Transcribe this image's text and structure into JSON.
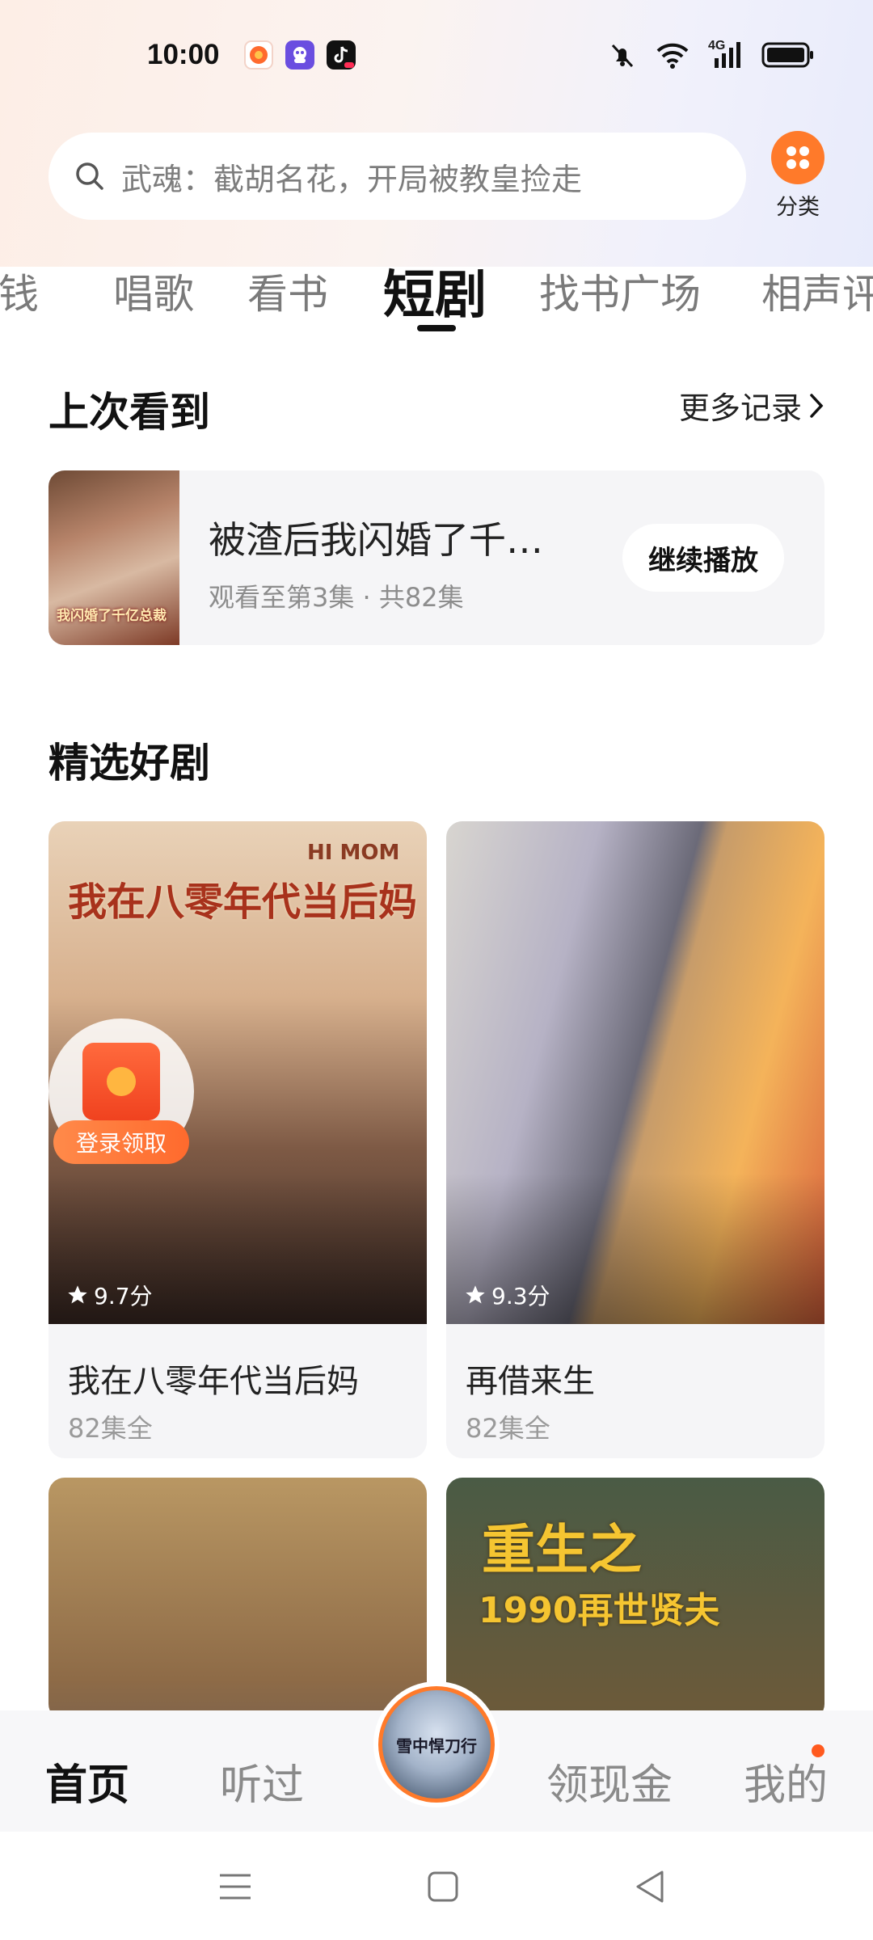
{
  "status_bar": {
    "time": "10:00",
    "network": "4G",
    "icons": [
      "mute-icon",
      "wifi-icon",
      "signal-icon",
      "battery-icon"
    ]
  },
  "search": {
    "placeholder": "武魂：截胡名花，开局被教皇捡走",
    "category_label": "分类"
  },
  "tabs": [
    {
      "label": "赚钱"
    },
    {
      "label": "唱歌"
    },
    {
      "label": "看书"
    },
    {
      "label": "短剧",
      "active": true
    },
    {
      "label": "找书广场"
    },
    {
      "label": "相声评书"
    }
  ],
  "recent": {
    "title": "上次看到",
    "more_label": "更多记录",
    "item": {
      "title": "被渣后我闪婚了千…",
      "progress": "观看至第3集 · 共82集",
      "button": "继续播放",
      "cover_text": "我闪婚了千亿总裁"
    }
  },
  "featured": {
    "title": "精选好剧",
    "items": [
      {
        "title": "我在八零年代当后妈",
        "episodes": "82集全",
        "rating": "9.7分",
        "cover_text": "我在八零年代当后妈",
        "cover_sub": "HI MOM"
      },
      {
        "title": "再借来生",
        "episodes": "82集全",
        "rating": "9.3分"
      },
      {
        "title": "",
        "episodes": ""
      },
      {
        "title": "",
        "episodes": "",
        "cover_text": "重生之",
        "cover_sub": "1990再世贤夫"
      }
    ]
  },
  "red_packet": {
    "label": "登录领取"
  },
  "bottom_nav": {
    "items": [
      "首页",
      "听过",
      "领现金",
      "我的"
    ],
    "center_text": "雪中悍刀行"
  },
  "colors": {
    "accent": "#ff7a2a",
    "badge_dot": "#ff5a1f"
  }
}
